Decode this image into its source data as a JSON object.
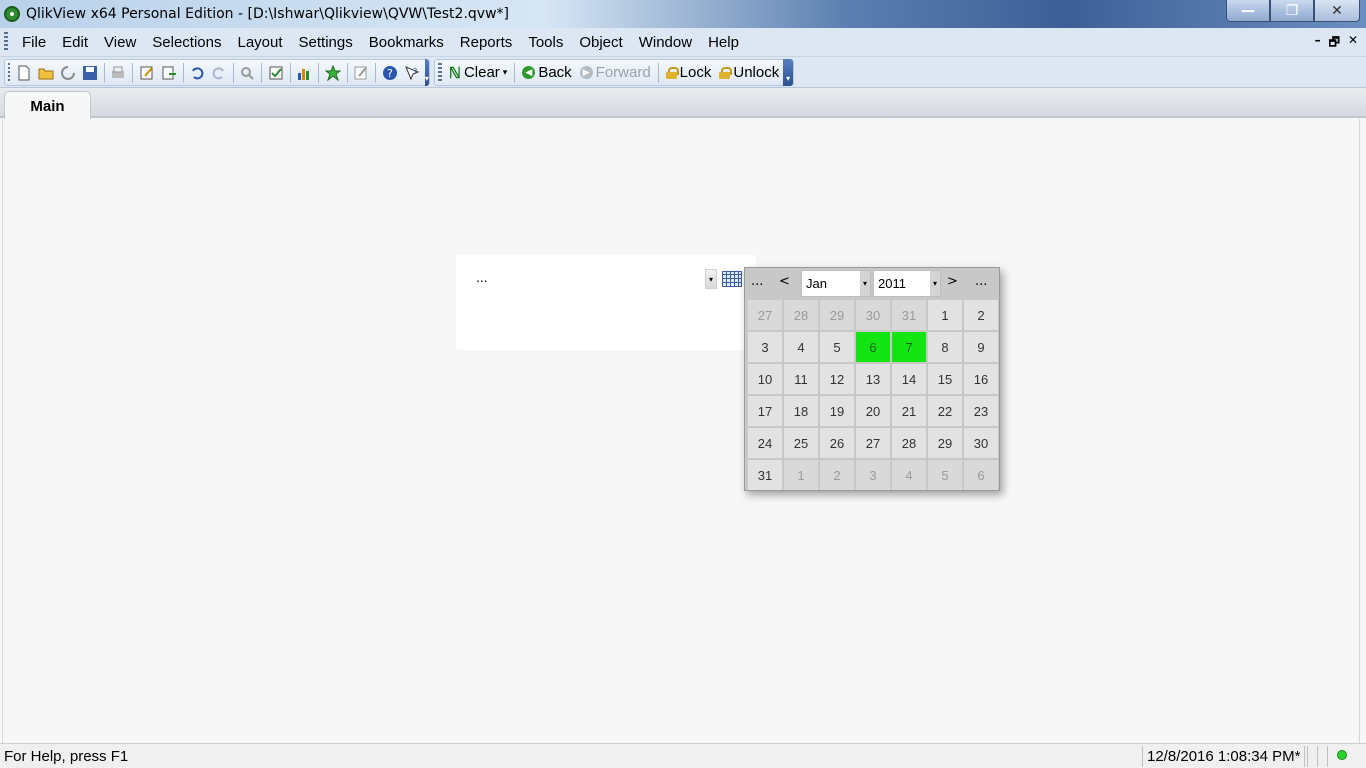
{
  "window": {
    "title": "QlikView x64 Personal Edition - [D:\\Ishwar\\Qlikview\\QVW\\Test2.qvw*]",
    "minimize_label": "—",
    "restore_label": "❐",
    "close_label": "✕"
  },
  "menu": {
    "items": [
      {
        "label": "File"
      },
      {
        "label": "Edit"
      },
      {
        "label": "View"
      },
      {
        "label": "Selections"
      },
      {
        "label": "Layout"
      },
      {
        "label": "Settings"
      },
      {
        "label": "Bookmarks"
      },
      {
        "label": "Reports"
      },
      {
        "label": "Tools"
      },
      {
        "label": "Object"
      },
      {
        "label": "Window"
      },
      {
        "label": "Help"
      }
    ],
    "mdi": {
      "minimize": "–",
      "restore": "🗗",
      "close": "✕"
    }
  },
  "toolbar": {
    "icons": [
      "new-icon",
      "open-icon",
      "reload-icon",
      "save-icon",
      "print-icon",
      "edit-script-icon",
      "export-icon",
      "undo-icon",
      "redo-icon",
      "search-icon",
      "select-icon",
      "chart-icon",
      "bookmark-icon",
      "properties-icon",
      "help-icon",
      "context-help-icon"
    ],
    "clear_label": "Clear",
    "back_label": "Back",
    "forward_label": "Forward",
    "lock_label": "Lock",
    "unlock_label": "Unlock"
  },
  "tabs": [
    {
      "label": "Main",
      "active": true
    }
  ],
  "calendar_object": {
    "value": "...",
    "popup": {
      "prev_far": "...",
      "prev": "<",
      "month": "Jan",
      "year": "2011",
      "next": ">",
      "next_far": "...",
      "days": [
        {
          "d": "27",
          "state": "other"
        },
        {
          "d": "28",
          "state": "other"
        },
        {
          "d": "29",
          "state": "other"
        },
        {
          "d": "30",
          "state": "other"
        },
        {
          "d": "31",
          "state": "other"
        },
        {
          "d": "1",
          "state": "normal"
        },
        {
          "d": "2",
          "state": "normal"
        },
        {
          "d": "3",
          "state": "normal"
        },
        {
          "d": "4",
          "state": "normal"
        },
        {
          "d": "5",
          "state": "normal"
        },
        {
          "d": "6",
          "state": "selected"
        },
        {
          "d": "7",
          "state": "selected"
        },
        {
          "d": "8",
          "state": "normal"
        },
        {
          "d": "9",
          "state": "normal"
        },
        {
          "d": "10",
          "state": "normal"
        },
        {
          "d": "11",
          "state": "normal"
        },
        {
          "d": "12",
          "state": "normal"
        },
        {
          "d": "13",
          "state": "normal"
        },
        {
          "d": "14",
          "state": "normal"
        },
        {
          "d": "15",
          "state": "normal"
        },
        {
          "d": "16",
          "state": "normal"
        },
        {
          "d": "17",
          "state": "normal"
        },
        {
          "d": "18",
          "state": "normal"
        },
        {
          "d": "19",
          "state": "normal"
        },
        {
          "d": "20",
          "state": "normal"
        },
        {
          "d": "21",
          "state": "normal"
        },
        {
          "d": "22",
          "state": "normal"
        },
        {
          "d": "23",
          "state": "normal"
        },
        {
          "d": "24",
          "state": "normal"
        },
        {
          "d": "25",
          "state": "normal"
        },
        {
          "d": "26",
          "state": "normal"
        },
        {
          "d": "27",
          "state": "normal"
        },
        {
          "d": "28",
          "state": "normal"
        },
        {
          "d": "29",
          "state": "normal"
        },
        {
          "d": "30",
          "state": "normal"
        },
        {
          "d": "31",
          "state": "normal"
        },
        {
          "d": "1",
          "state": "other"
        },
        {
          "d": "2",
          "state": "other"
        },
        {
          "d": "3",
          "state": "other"
        },
        {
          "d": "4",
          "state": "other"
        },
        {
          "d": "5",
          "state": "other"
        },
        {
          "d": "6",
          "state": "other"
        }
      ]
    }
  },
  "status": {
    "help_text": "For Help, press F1",
    "timestamp": "12/8/2016 1:08:34 PM*"
  },
  "colors": {
    "selected_green": "#12e512",
    "menu_bg": "#dde7f4",
    "status_led": "#2bd12b"
  }
}
